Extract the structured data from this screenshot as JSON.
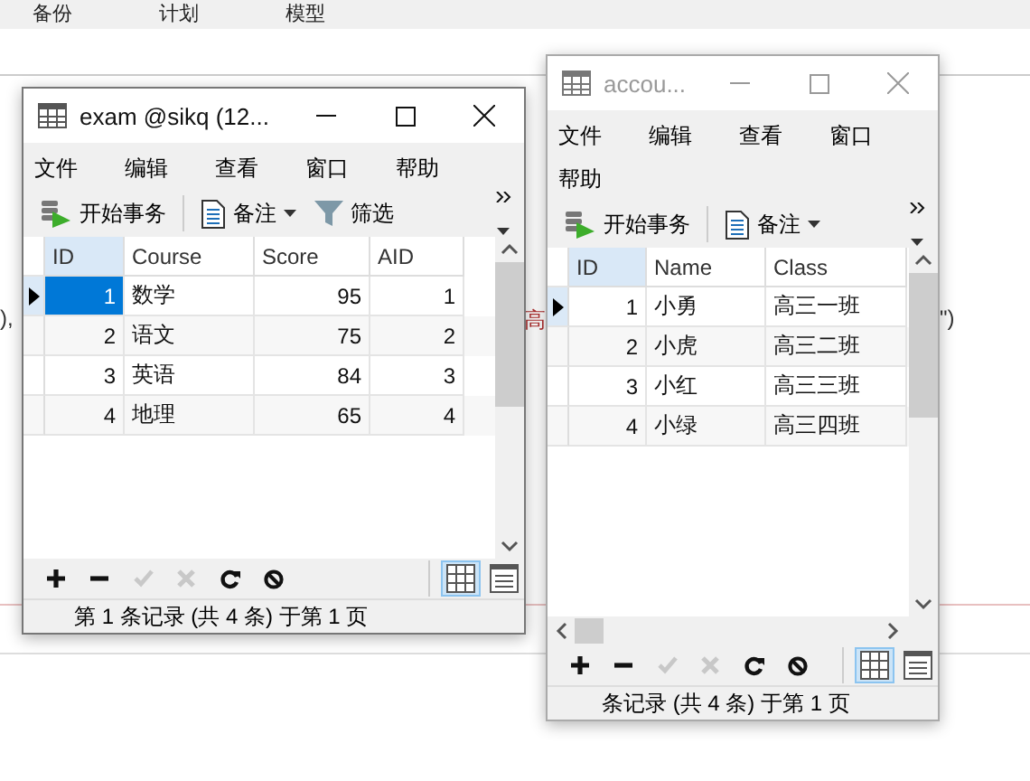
{
  "background": {
    "tabs": [
      "备份",
      "计划",
      "模型"
    ],
    "code_fragments": [
      "),",
      "高",
      "\")"
    ]
  },
  "windows": [
    {
      "title": "exam @sikq (12...",
      "active": true,
      "menu": [
        "文件",
        "编辑",
        "查看",
        "窗口",
        "帮助"
      ],
      "toolbar": [
        {
          "kind": "transaction",
          "label": "开始事务"
        },
        {
          "kind": "memo",
          "label": "备注"
        },
        {
          "kind": "filter",
          "label": "筛选"
        }
      ],
      "columns": [
        "ID",
        "Course",
        "Score",
        "AID"
      ],
      "rows": [
        {
          "current": true,
          "cells": [
            "1",
            "数学",
            "95",
            "1"
          ]
        },
        {
          "current": false,
          "cells": [
            "2",
            "语文",
            "75",
            "2"
          ]
        },
        {
          "current": false,
          "cells": [
            "3",
            "英语",
            "84",
            "3"
          ]
        },
        {
          "current": false,
          "cells": [
            "4",
            "地理",
            "65",
            "4"
          ]
        }
      ],
      "focused_id_cell": true,
      "horizontal_scrollbar": false,
      "nav_buttons": [
        {
          "kind": "add",
          "disabled": false
        },
        {
          "kind": "delete",
          "disabled": false
        },
        {
          "kind": "apply",
          "disabled": true
        },
        {
          "kind": "cancel",
          "disabled": true
        },
        {
          "kind": "refresh",
          "disabled": false
        },
        {
          "kind": "stop",
          "disabled": false
        }
      ],
      "views": [
        {
          "kind": "grid",
          "selected": true
        },
        {
          "kind": "form",
          "selected": false
        }
      ],
      "status": "第 1 条记录 (共 4 条) 于第 1 页"
    },
    {
      "title": "accou...",
      "active": false,
      "menu": [
        "文件",
        "编辑",
        "查看",
        "窗口",
        "帮助"
      ],
      "toolbar": [
        {
          "kind": "transaction",
          "label": "开始事务"
        },
        {
          "kind": "memo",
          "label": "备注"
        }
      ],
      "columns": [
        "ID",
        "Name",
        "Class"
      ],
      "rows": [
        {
          "current": true,
          "cells": [
            "1",
            "小勇",
            "高三一班"
          ]
        },
        {
          "current": false,
          "cells": [
            "2",
            "小虎",
            "高三二班"
          ]
        },
        {
          "current": false,
          "cells": [
            "3",
            "小红",
            "高三三班"
          ]
        },
        {
          "current": false,
          "cells": [
            "4",
            "小绿",
            "高三四班"
          ]
        }
      ],
      "focused_id_cell": false,
      "horizontal_scrollbar": true,
      "nav_buttons": [
        {
          "kind": "add",
          "disabled": false
        },
        {
          "kind": "delete",
          "disabled": false
        },
        {
          "kind": "apply",
          "disabled": true
        },
        {
          "kind": "cancel",
          "disabled": true
        },
        {
          "kind": "refresh",
          "disabled": false
        },
        {
          "kind": "stop",
          "disabled": false
        }
      ],
      "views": [
        {
          "kind": "grid",
          "selected": true
        },
        {
          "kind": "form",
          "selected": false
        }
      ],
      "status": "条记录 (共 4 条) 于第 1 页"
    }
  ]
}
